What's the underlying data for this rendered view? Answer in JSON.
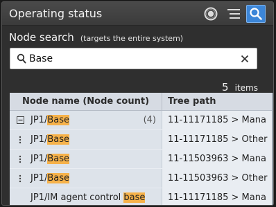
{
  "window": {
    "title": "Operating status"
  },
  "toolbar": {
    "icons": [
      "status-icon",
      "list-icon",
      "search-icon"
    ]
  },
  "search": {
    "heading": "Node search",
    "subheading": "(targets the entire system)",
    "query": "Base",
    "result_count": "5",
    "result_unit": "items"
  },
  "table": {
    "columns": [
      "Node name (Node count)",
      "Tree path"
    ],
    "rows": [
      {
        "prefix": "JP1/",
        "match": "Base",
        "count": "(4)",
        "path": "11-11171185 > Mana",
        "control": "collapse"
      },
      {
        "prefix": "JP1/",
        "match": "Base",
        "count": "",
        "path": "11-11171185 > Other",
        "control": "dots"
      },
      {
        "prefix": "JP1/",
        "match": "Base",
        "count": "",
        "path": "11-11503963 > Mana",
        "control": "dots"
      },
      {
        "prefix": "JP1/",
        "match": "Base",
        "count": "",
        "path": "11-11503963 > Other",
        "control": "dots"
      },
      {
        "prefix": "JP1/IM agent control ",
        "match": "base",
        "count": "",
        "path": "11-11171185 > Mana",
        "control": "none"
      }
    ]
  },
  "colors": {
    "highlight": "#f6b24a",
    "active_button": "#3c86d8"
  }
}
